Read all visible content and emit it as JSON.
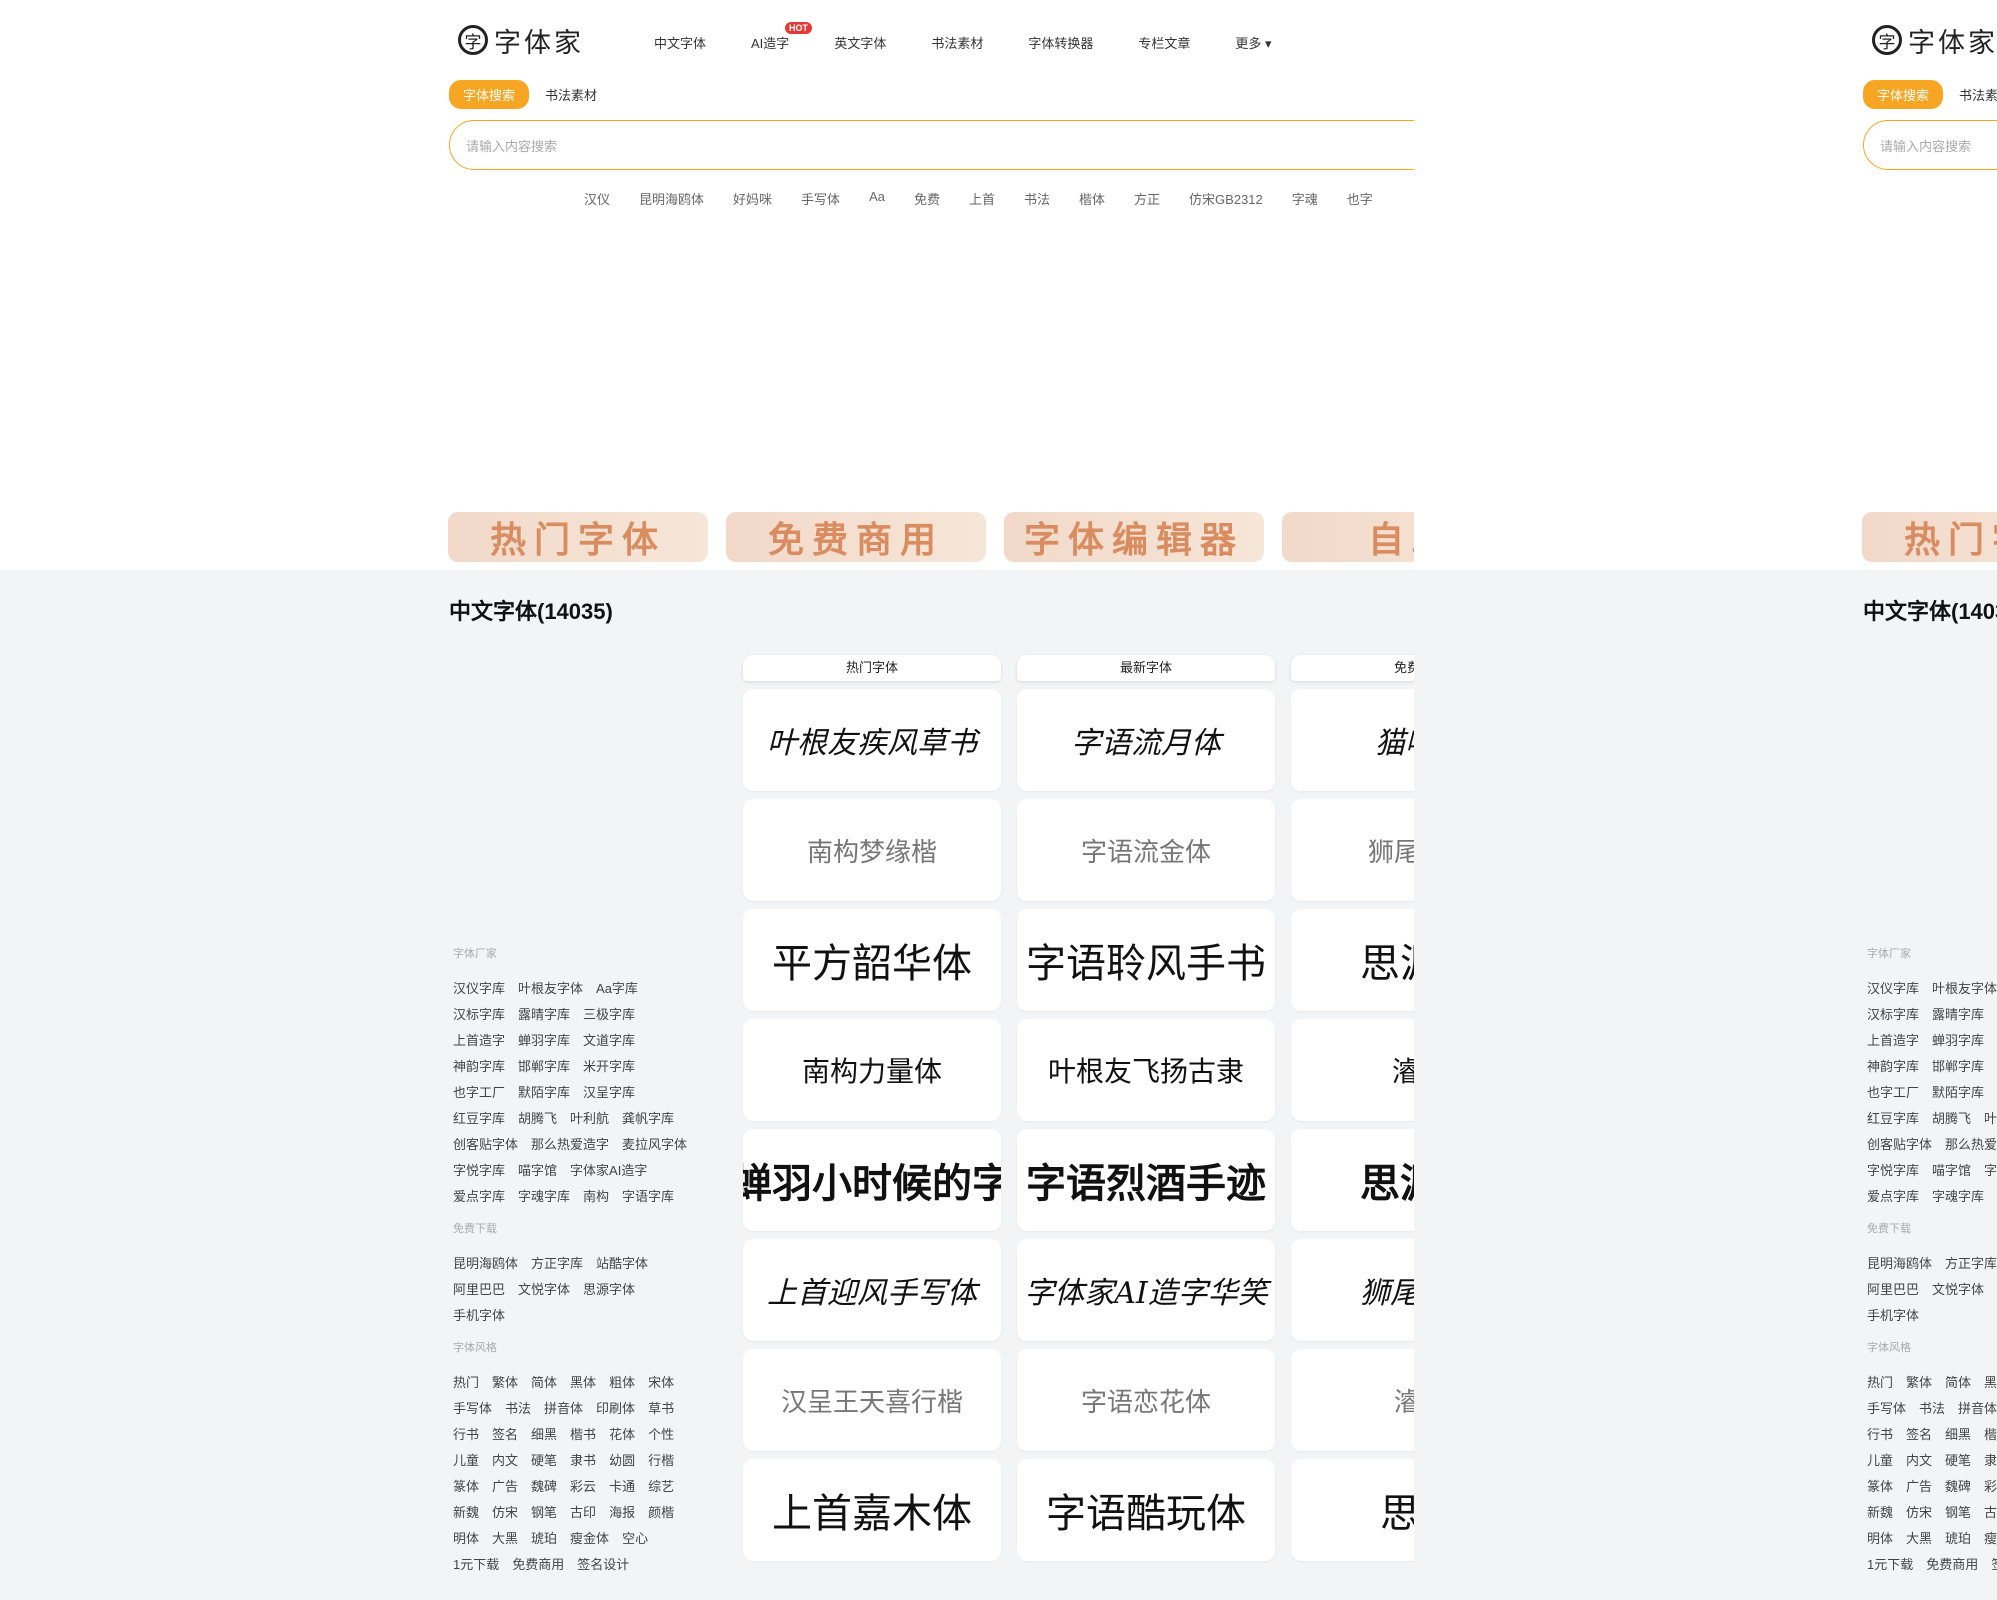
{
  "logo": {
    "mark": "字",
    "text": "字体家"
  },
  "nav": {
    "items": [
      "中文字体",
      "AI造字",
      "英文字体",
      "书法素材",
      "字体转换器",
      "专栏文章",
      "更多 ▾"
    ],
    "hot_badge": "HOT"
  },
  "search_tabs": {
    "active": "字体搜索",
    "other": "书法素材"
  },
  "search": {
    "placeholder": "请输入内容搜索"
  },
  "keywords": [
    "汉仪",
    "昆明海鸥体",
    "好妈咪",
    "手写体",
    "Aa",
    "免费",
    "上首",
    "书法",
    "楷体",
    "方正",
    "仿宋GB2312",
    "字魂",
    "也字"
  ],
  "banners": [
    "热门字体",
    "免费商用",
    "字体编辑器",
    "自助"
  ],
  "section_title": "中文字体(14035)",
  "sidebar": {
    "manufacturers_title": "字体厂家",
    "manufacturers": [
      "汉仪字库",
      "叶根友字体",
      "Aa字库",
      "汉标字库",
      "露晴字库",
      "三极字库",
      "上首造字",
      "蝉羽字库",
      "文道字库",
      "神韵字库",
      "邯郸字库",
      "米开字库",
      "也字工厂",
      "默陌字库",
      "汉呈字库",
      "红豆字库",
      "胡腾飞",
      "叶利航",
      "龚帆字库",
      "创客贴字体",
      "那么热爱造字",
      "麦拉风字体",
      "字悦字库",
      "喵字馆",
      "字体家AI造字",
      "爱点字库",
      "字魂字库",
      "南构",
      "字语字库"
    ],
    "free_title": "免费下载",
    "free": [
      "昆明海鸥体",
      "方正字库",
      "站酷字体",
      "阿里巴巴",
      "文悦字体",
      "思源字体",
      "手机字体"
    ],
    "style_title": "字体风格",
    "styles": [
      "热门",
      "繁体",
      "简体",
      "黑体",
      "粗体",
      "宋体",
      "手写体",
      "书法",
      "拼音体",
      "印刷体",
      "草书",
      "行书",
      "签名",
      "细黑",
      "楷书",
      "花体",
      "个性",
      "儿童",
      "内文",
      "硬笔",
      "隶书",
      "幼圆",
      "行楷",
      "篆体",
      "广告",
      "魏碑",
      "彩云",
      "卡通",
      "综艺",
      "新魏",
      "仿宋",
      "钢笔",
      "古印",
      "海报",
      "颜楷",
      "明体",
      "大黑",
      "琥珀",
      "瘦金体",
      "空心",
      "1元下载",
      "免费商用",
      "签名设计"
    ]
  },
  "columns": [
    {
      "title": "热门字体",
      "fonts": [
        "叶根友疾风草书",
        "南构梦缘楷",
        "平方韶华体",
        "南构力量体",
        "蝉羽小时候的字",
        "上首迎风手写体",
        "汉呈王天喜行楷",
        "上首嘉木体"
      ]
    },
    {
      "title": "最新字体",
      "fonts": [
        "字语流月体",
        "字语流金体",
        "字语聆风手书",
        "叶根友飞扬古隶",
        "字语烈酒手迹",
        "字体家AI造字华笑",
        "字语恋花体",
        "字语酷玩体"
      ]
    },
    {
      "title": "免费商用",
      "fonts": [
        "猫啃网",
        "狮尾麦克",
        "思源黑",
        "濬雅",
        "思源黑",
        "狮尾麦克",
        "濬雅",
        "思源"
      ]
    }
  ]
}
